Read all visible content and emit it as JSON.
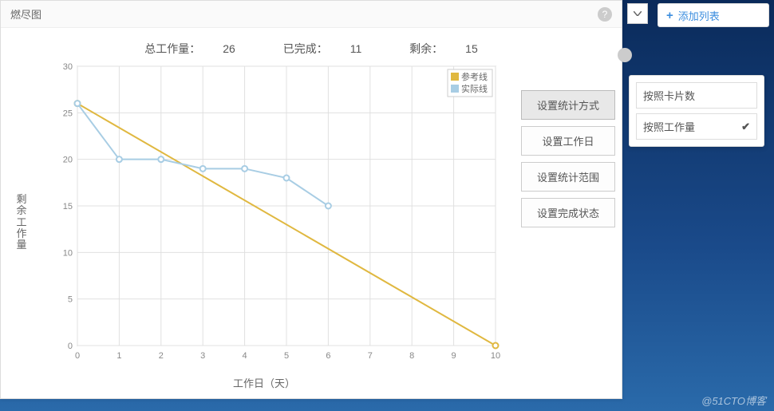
{
  "panel": {
    "title": "燃尽图",
    "help_icon": "?"
  },
  "summary": {
    "total_label": "总工作量：",
    "total_value": "26",
    "done_label": "已完成：",
    "done_value": "11",
    "remain_label": "剩余：",
    "remain_value": "15"
  },
  "chart_data": {
    "type": "line",
    "title": "",
    "xlabel": "工作日（天）",
    "ylabel": "剩余工作量",
    "xlim": [
      0,
      10
    ],
    "ylim": [
      0,
      30
    ],
    "x_ticks": [
      0,
      1,
      2,
      3,
      4,
      5,
      6,
      7,
      8,
      9,
      10
    ],
    "y_ticks": [
      0,
      5,
      10,
      15,
      20,
      25,
      30
    ],
    "series": [
      {
        "name": "参考线",
        "color": "#e0b840",
        "x": [
          0,
          10
        ],
        "y": [
          26,
          0
        ]
      },
      {
        "name": "实际线",
        "color": "#a8cde4",
        "x": [
          0,
          1,
          2,
          3,
          4,
          5,
          6
        ],
        "y": [
          26,
          20,
          20,
          19,
          19,
          18,
          15
        ]
      }
    ],
    "legend": [
      "参考线",
      "实际线"
    ]
  },
  "settings": {
    "options": [
      "设置统计方式",
      "设置工作日",
      "设置统计范围",
      "设置完成状态"
    ],
    "active_index": 0
  },
  "popup": {
    "items": [
      "按照卡片数",
      "按照工作量"
    ],
    "selected_index": 1
  },
  "add_column_label": "添加列表",
  "watermark": "@51CTO博客"
}
